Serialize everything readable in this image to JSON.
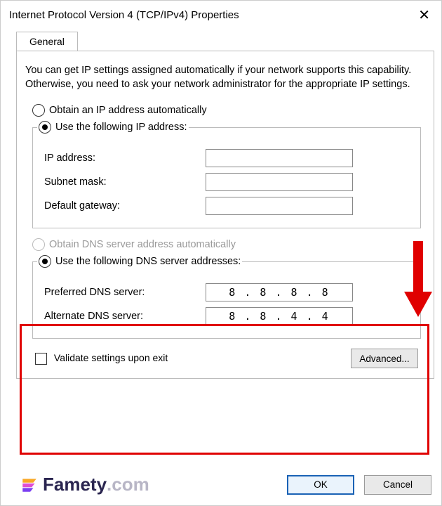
{
  "window": {
    "title": "Internet Protocol Version 4 (TCP/IPv4) Properties"
  },
  "tabs": {
    "general": "General"
  },
  "intro": "You can get IP settings assigned automatically if your network supports this capability. Otherwise, you need to ask your network administrator for the appropriate IP settings.",
  "ip": {
    "auto_label": "Obtain an IP address automatically",
    "manual_label": "Use the following IP address:",
    "address_label": "IP address:",
    "subnet_label": "Subnet mask:",
    "gateway_label": "Default gateway:",
    "address_value": "",
    "subnet_value": "",
    "gateway_value": ""
  },
  "dns": {
    "auto_label": "Obtain DNS server address automatically",
    "manual_label": "Use the following DNS server addresses:",
    "preferred_label": "Preferred DNS server:",
    "alternate_label": "Alternate DNS server:",
    "preferred_value": "8 . 8 . 8 . 8",
    "alternate_value": "8 . 8 . 4 . 4"
  },
  "validate_label": "Validate settings upon exit",
  "buttons": {
    "advanced": "Advanced...",
    "ok": "OK",
    "cancel": "Cancel"
  },
  "brand": {
    "name": "Famety",
    "suffix": ".com"
  },
  "colors": {
    "highlight": "#e00000",
    "primary_border": "#1a62b5"
  }
}
